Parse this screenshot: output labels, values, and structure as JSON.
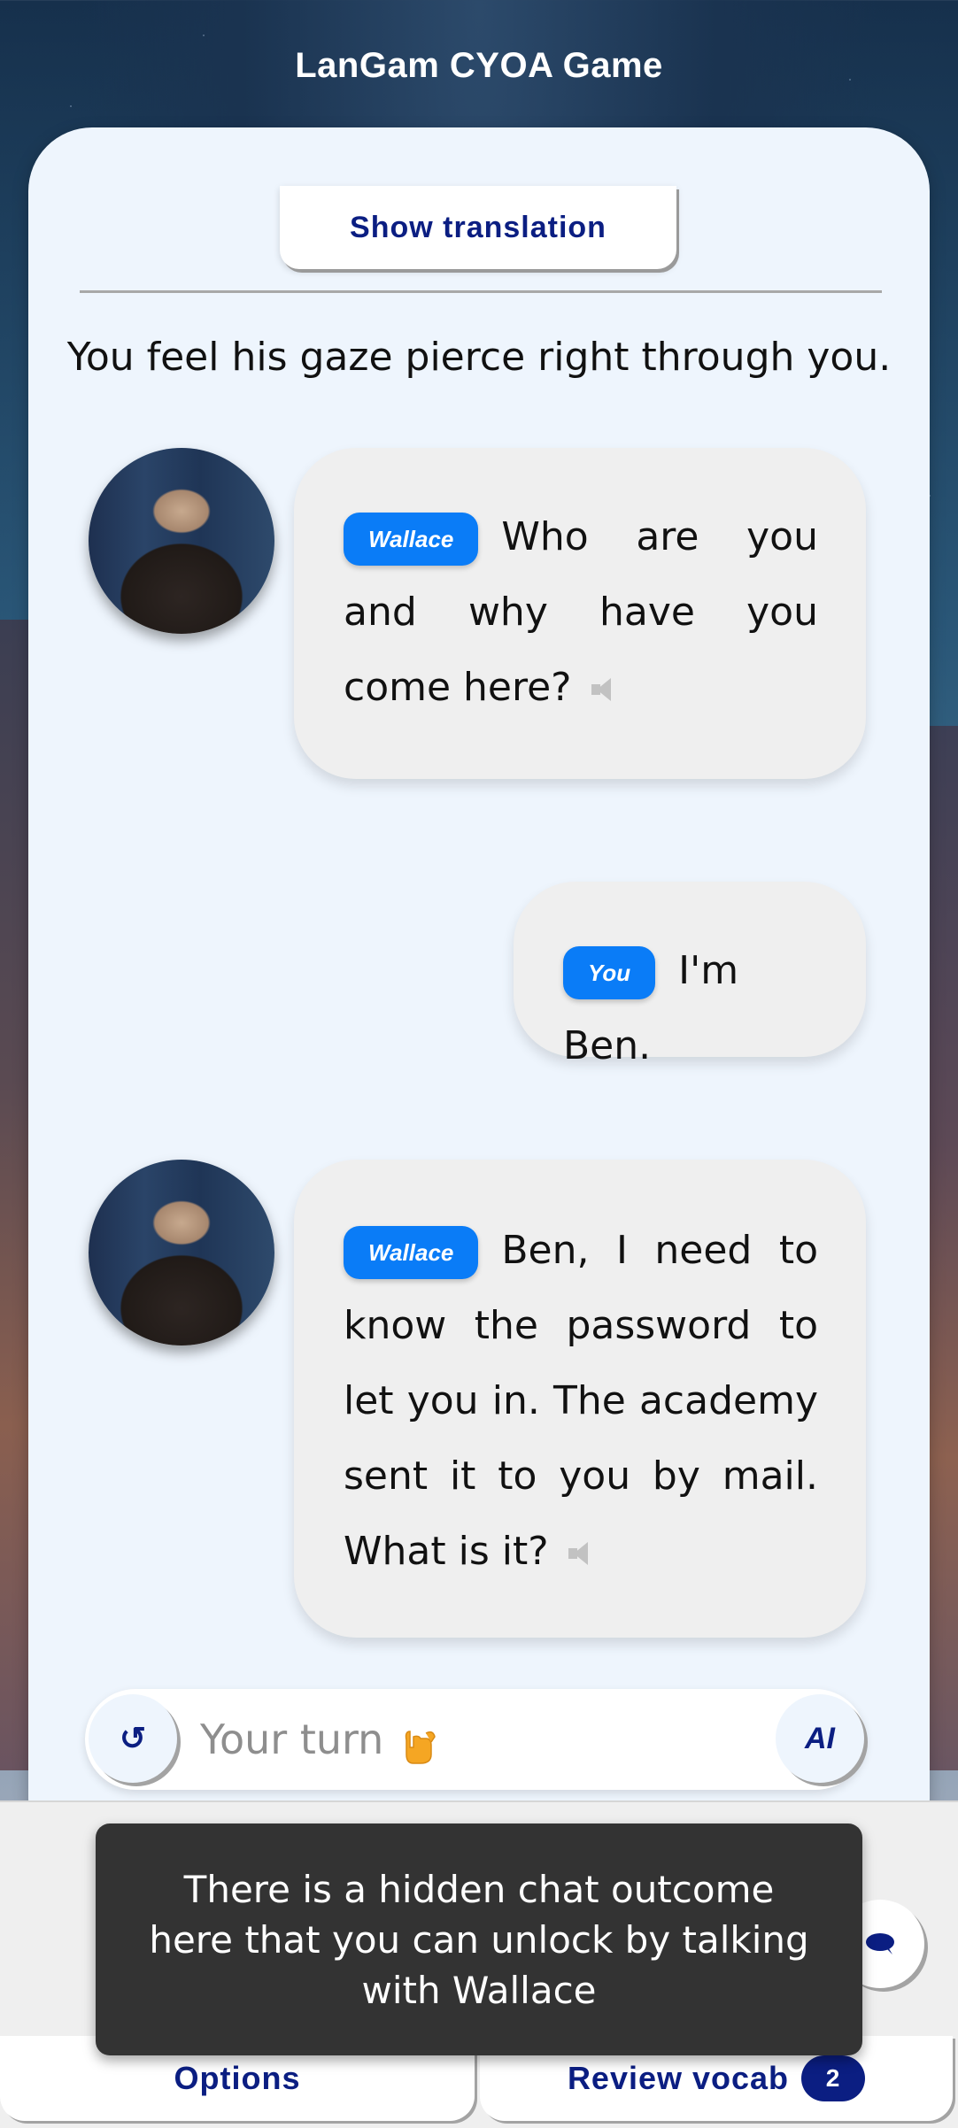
{
  "app": {
    "title": "LanGam CYOA Game"
  },
  "controls": {
    "show_translation_label": "Show translation"
  },
  "narration": "You feel his gaze pierce right through you.",
  "messages": [
    {
      "speaker": "Wallace",
      "text": "Who are you and why have you come here?",
      "side": "left",
      "has_audio": true
    },
    {
      "speaker": "You",
      "text": "I'm Ben.",
      "side": "right",
      "has_audio": false
    },
    {
      "speaker": "Wallace",
      "text": "Ben, I need to know the password to let you in. The academy sent it to you by mail. What is it?",
      "side": "left",
      "has_audio": true
    }
  ],
  "input": {
    "placeholder": "Your turn",
    "emoji": "🤙",
    "reset_icon": "↺",
    "ai_label": "AI"
  },
  "toast": {
    "text": "There is a hidden chat outcome here that you can unlock by talking with Wallace"
  },
  "bottom_nav": {
    "options_label": "Options",
    "review_vocab_label": "Review vocab",
    "review_vocab_count": "2"
  },
  "colors": {
    "accent_navy": "#0b1e82",
    "speaker_tag_blue": "#0a7cf7",
    "card_bg": "#eef5fd",
    "bubble_bg": "#efefef",
    "toast_bg": "#333333"
  },
  "icons": [
    "speaker-icon",
    "reset-icon",
    "hand-emoji-icon",
    "chat-bubble-icon",
    "avatar-portrait"
  ]
}
